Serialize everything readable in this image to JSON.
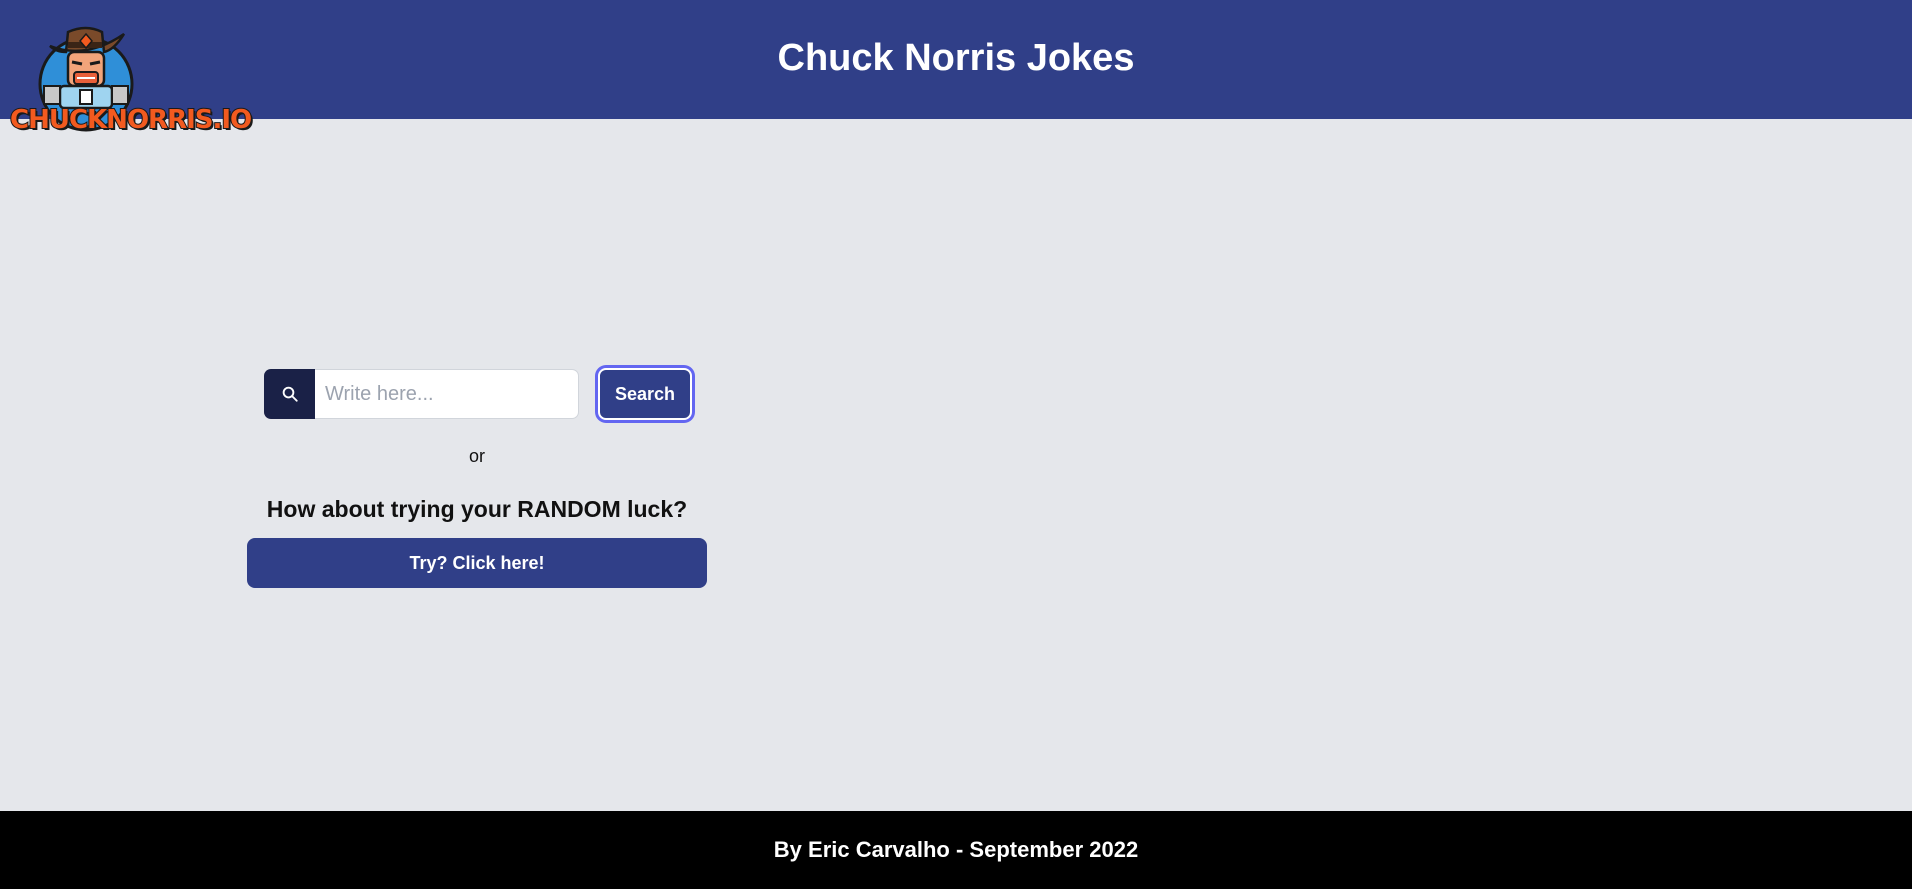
{
  "header": {
    "title": "Chuck Norris Jokes",
    "logo_text": "CHUCKNORRIS.IO"
  },
  "search": {
    "placeholder": "Write here...",
    "value": "",
    "button_label": "Search",
    "icon": "search-icon"
  },
  "divider_text": "or",
  "random": {
    "heading": "How about trying your RANDOM luck?",
    "button_label": "Try? Click here!"
  },
  "footer": {
    "text": "By Eric Carvalho - September 2022"
  },
  "colors": {
    "header_bg": "#303f88",
    "page_bg": "#e5e7eb",
    "icon_box_bg": "#1a2147",
    "button_bg": "#303f88",
    "focus_ring": "#6366f1",
    "footer_bg": "#000000",
    "logo_orange": "#f25a1f"
  }
}
